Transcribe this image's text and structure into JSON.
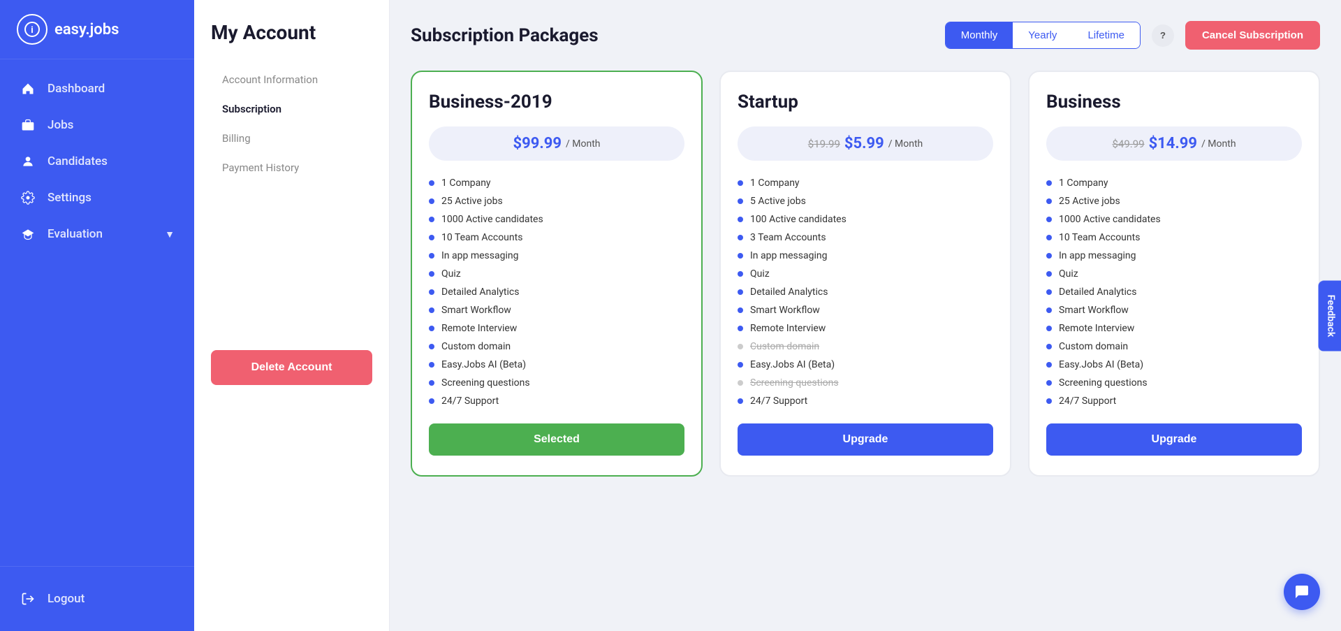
{
  "app": {
    "name": "easy.jobs",
    "logo_letter": "i"
  },
  "sidebar": {
    "items": [
      {
        "label": "Dashboard",
        "icon": "home"
      },
      {
        "label": "Jobs",
        "icon": "briefcase"
      },
      {
        "label": "Candidates",
        "icon": "user"
      },
      {
        "label": "Settings",
        "icon": "gear"
      },
      {
        "label": "Evaluation",
        "icon": "graduation",
        "has_arrow": true
      }
    ],
    "logout_label": "Logout"
  },
  "account": {
    "title": "My Account",
    "menu": [
      {
        "label": "Account Information"
      },
      {
        "label": "Subscription"
      },
      {
        "label": "Billing"
      },
      {
        "label": "Payment History"
      }
    ],
    "delete_button": "Delete Account"
  },
  "subscription": {
    "title": "Subscription Packages",
    "billing_options": [
      "Monthly",
      "Yearly",
      "Lifetime"
    ],
    "active_billing": "Monthly",
    "cancel_button": "Cancel Subscription",
    "help_icon": "?",
    "plans": [
      {
        "name": "Business-2019",
        "price_current": "$99.99",
        "price_old": "",
        "period": "/ Month",
        "is_selected": true,
        "action_label": "Selected",
        "features": [
          {
            "text": "1 Company",
            "disabled": false
          },
          {
            "text": "25 Active jobs",
            "disabled": false
          },
          {
            "text": "1000 Active candidates",
            "disabled": false
          },
          {
            "text": "10 Team Accounts",
            "disabled": false
          },
          {
            "text": "In app messaging",
            "disabled": false
          },
          {
            "text": "Quiz",
            "disabled": false
          },
          {
            "text": "Detailed Analytics",
            "disabled": false
          },
          {
            "text": "Smart Workflow",
            "disabled": false
          },
          {
            "text": "Remote Interview",
            "disabled": false
          },
          {
            "text": "Custom domain",
            "disabled": false
          },
          {
            "text": "Easy.Jobs AI (Beta)",
            "disabled": false
          },
          {
            "text": "Screening questions",
            "disabled": false
          },
          {
            "text": "24/7 Support",
            "disabled": false
          }
        ]
      },
      {
        "name": "Startup",
        "price_current": "$5.99",
        "price_old": "$19.99",
        "period": "/ Month",
        "is_selected": false,
        "action_label": "Upgrade",
        "features": [
          {
            "text": "1 Company",
            "disabled": false
          },
          {
            "text": "5 Active jobs",
            "disabled": false
          },
          {
            "text": "100 Active candidates",
            "disabled": false
          },
          {
            "text": "3 Team Accounts",
            "disabled": false
          },
          {
            "text": "In app messaging",
            "disabled": false
          },
          {
            "text": "Quiz",
            "disabled": false
          },
          {
            "text": "Detailed Analytics",
            "disabled": false
          },
          {
            "text": "Smart Workflow",
            "disabled": false
          },
          {
            "text": "Remote Interview",
            "disabled": false
          },
          {
            "text": "Custom domain",
            "disabled": true
          },
          {
            "text": "Easy.Jobs AI (Beta)",
            "disabled": false
          },
          {
            "text": "Screening questions",
            "disabled": true
          },
          {
            "text": "24/7 Support",
            "disabled": false
          }
        ]
      },
      {
        "name": "Business",
        "price_current": "$14.99",
        "price_old": "$49.99",
        "period": "/ Month",
        "is_selected": false,
        "action_label": "Upgrade",
        "features": [
          {
            "text": "1 Company",
            "disabled": false
          },
          {
            "text": "25 Active jobs",
            "disabled": false
          },
          {
            "text": "1000 Active candidates",
            "disabled": false
          },
          {
            "text": "10 Team Accounts",
            "disabled": false
          },
          {
            "text": "In app messaging",
            "disabled": false
          },
          {
            "text": "Quiz",
            "disabled": false
          },
          {
            "text": "Detailed Analytics",
            "disabled": false
          },
          {
            "text": "Smart Workflow",
            "disabled": false
          },
          {
            "text": "Remote Interview",
            "disabled": false
          },
          {
            "text": "Custom domain",
            "disabled": false
          },
          {
            "text": "Easy.Jobs AI (Beta)",
            "disabled": false
          },
          {
            "text": "Screening questions",
            "disabled": false
          },
          {
            "text": "24/7 Support",
            "disabled": false
          }
        ]
      }
    ]
  },
  "feedback": {
    "label": "Feedback"
  },
  "chat": {
    "icon": "💬"
  }
}
